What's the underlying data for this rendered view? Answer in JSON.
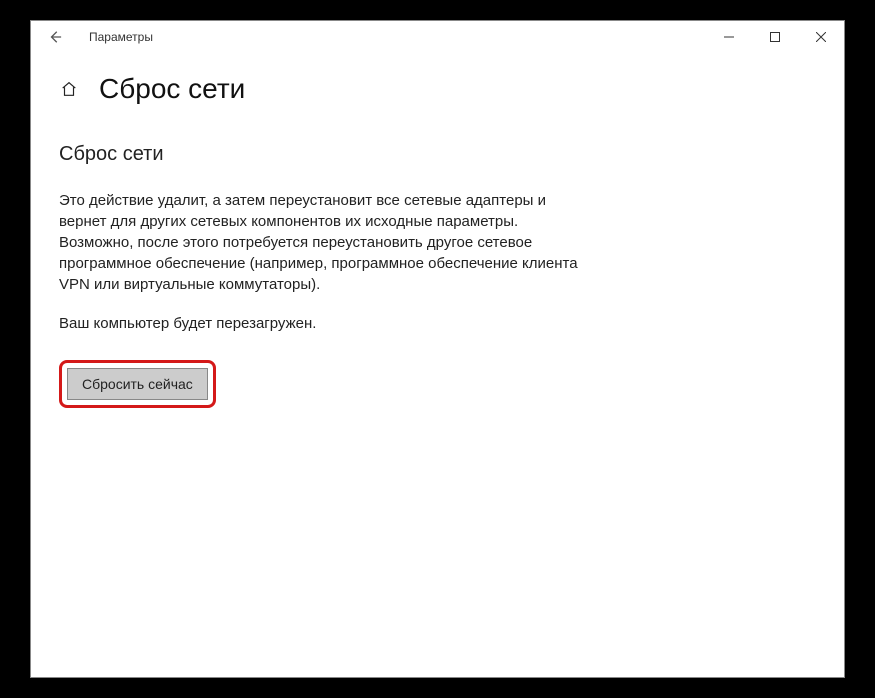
{
  "titlebar": {
    "label": "Параметры"
  },
  "page": {
    "title": "Сброс сети",
    "subheading": "Сброс сети",
    "description": "Это действие удалит, а затем переустановит все сетевые адаптеры и вернет для других сетевых компонентов их исходные параметры. Возможно, после этого потребуется переустановить другое сетевое программное обеспечение (например, программное обеспечение клиента VPN или виртуальные коммутаторы).",
    "restart_note": "Ваш компьютер будет перезагружен.",
    "reset_button": "Сбросить сейчас"
  }
}
